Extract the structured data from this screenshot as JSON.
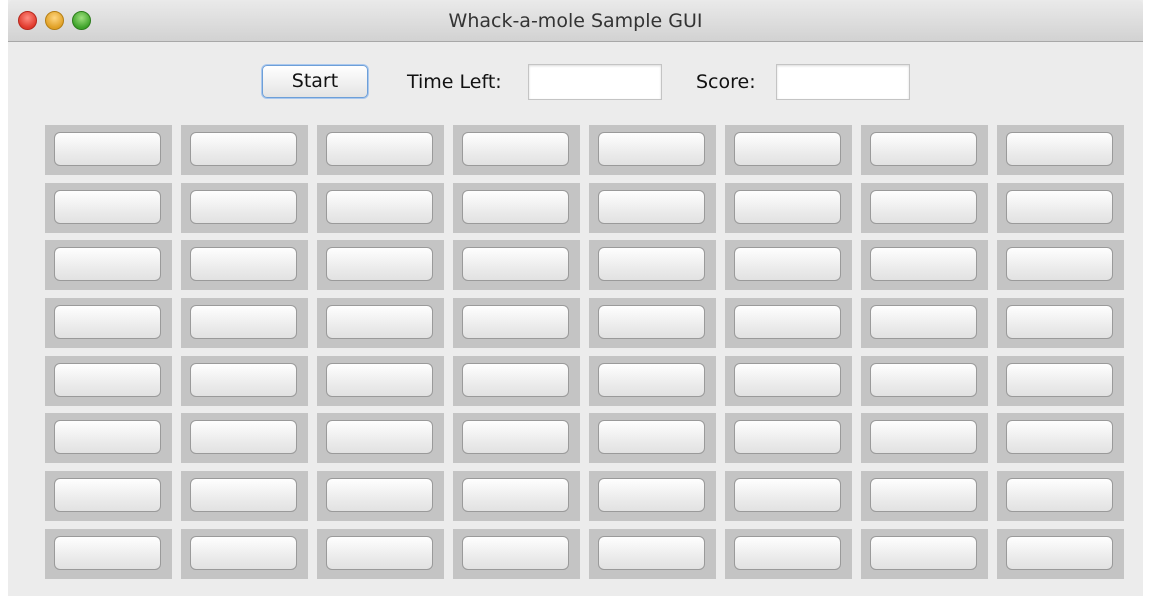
{
  "window": {
    "title": "Whack-a-mole Sample GUI"
  },
  "toolbar": {
    "start_label": "Start",
    "time_left_label": "Time Left:",
    "time_left_value": "",
    "score_label": "Score:",
    "score_value": ""
  },
  "grid": {
    "rows": 8,
    "columns": 8,
    "button_label": ""
  }
}
